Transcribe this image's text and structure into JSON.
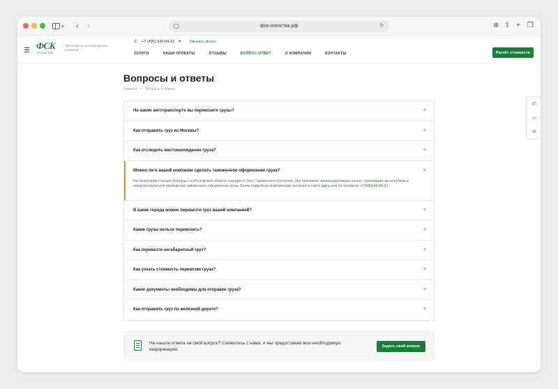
{
  "browser": {
    "url": "фск-логистик.рф"
  },
  "header": {
    "tagline": "Транспортно-экспедиторская компания",
    "phone": "+7 (495) 649-84-32",
    "callback": "Заказать звонок",
    "menu": [
      "УСЛУГИ",
      "НАШИ ПРОЕКТЫ",
      "ОТЗЫВЫ",
      "ВОПРОС-ОТВЕТ",
      "О КОМПАНИИ",
      "КОНТАКТЫ"
    ],
    "active_menu_index": 3,
    "calc_button": "Расчёт стоимости",
    "logo_text": "ФСК",
    "logo_sub": "ЛОГИСТИК"
  },
  "page": {
    "title": "Вопросы и ответы",
    "breadcrumb": [
      "Главная",
      "—",
      "Вопросы и ответы"
    ]
  },
  "faq": {
    "items": [
      {
        "q": "На каком автотранспорте вы перевозите грузы?"
      },
      {
        "q": "Как отправить груз из Москвы?"
      },
      {
        "q": "Как отследить местонахождение груза?"
      },
      {
        "q": "Можно ли в вашей компании сделать таможенное оформление груза?"
      },
      {
        "q": "В какие города можно перевезти груз вашей компанией?"
      },
      {
        "q": "Какие грузы нельзя перевозить?"
      },
      {
        "q": "Как перевезти негабаритный груз?"
      },
      {
        "q": "Как узнать стоимость перевозки груза?"
      },
      {
        "q": "Какие документы необходимы для отправки груза?"
      },
      {
        "q": "Как отправить груз по железной дороге?"
      }
    ],
    "open_answer": {
      "text": "На территории станции Люберцы I в Московской области, находится Зона Таможенного Контроля. Она принимает железнодорожные вагоны, пришедшие из-за рубежа и предусмотрена для проведения таможенного оформления груза. Более подробную информацию вы можете найти",
      "link": "здесь",
      "text2": "или по телефону",
      "phone": "+7(495)649-84-32."
    },
    "plus_symbol": "+",
    "close_symbol": "×"
  },
  "cta": {
    "text": "Не нашли ответа на свой вопрос? Свяжитесь с нами, и мы предоставим всю необходимую информацию.",
    "button": "Задать свой вопрос"
  },
  "colors": {
    "brand_green": "#1b7d3a",
    "accent_gold": "#c9a227"
  }
}
